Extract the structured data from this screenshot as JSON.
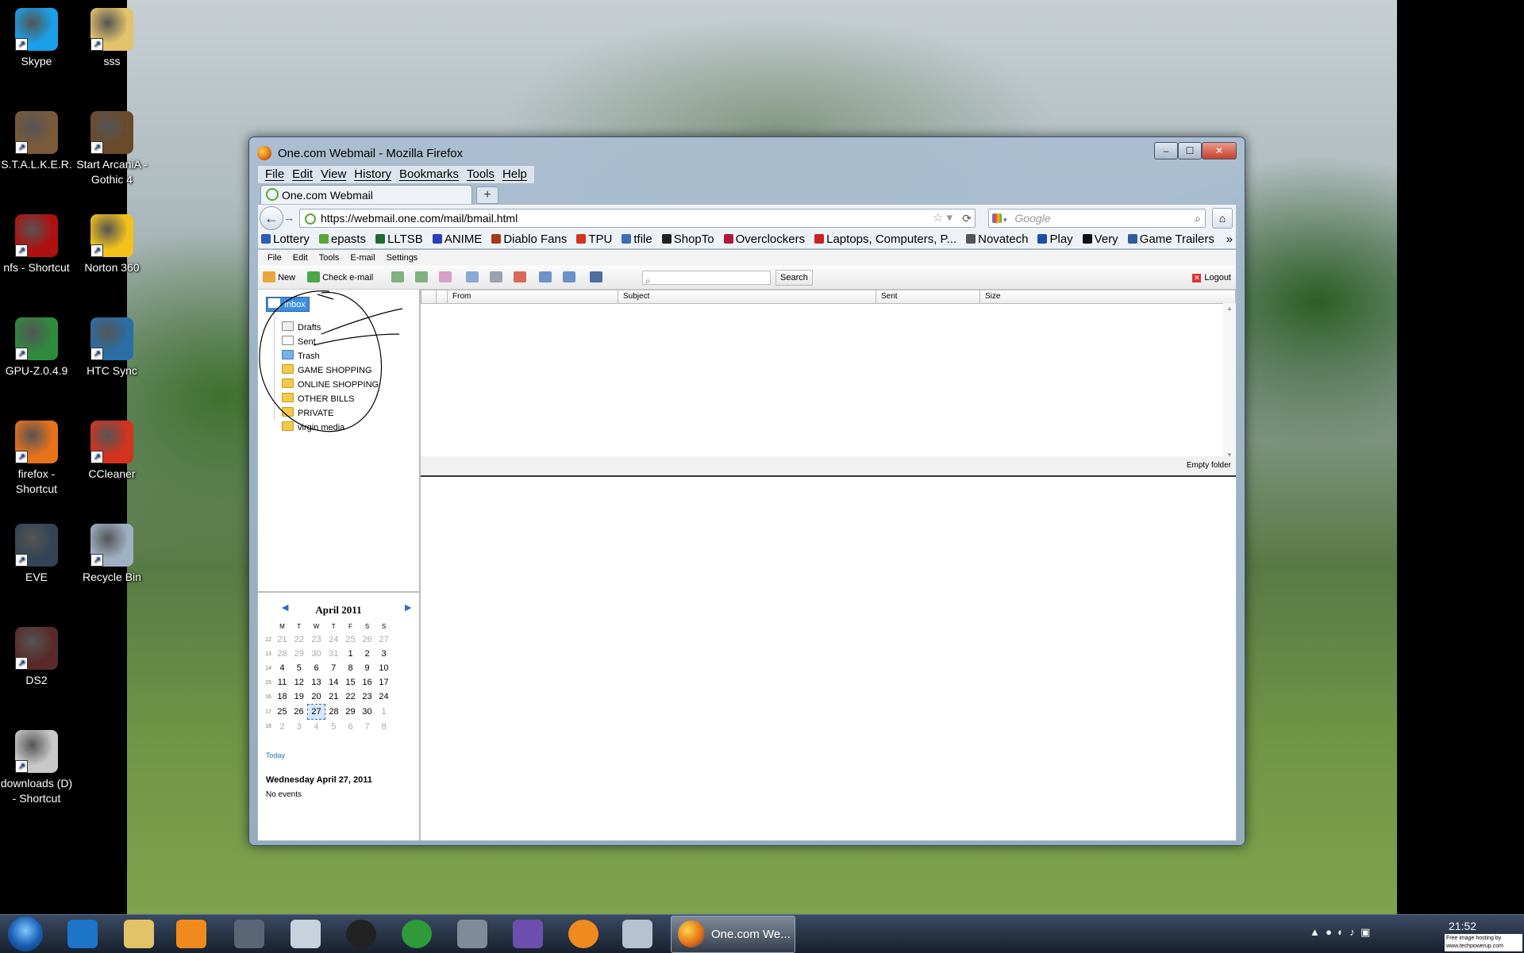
{
  "desktop": {
    "icons": [
      {
        "label": "Skype",
        "color": "#1aa0e8"
      },
      {
        "label": "sss",
        "color": "#e3c36a"
      },
      {
        "label": "S.T.A.L.K.E.R.",
        "color": "#7a5a3a"
      },
      {
        "label": "Start ArcaniA - Gothic 4",
        "color": "#6b4a2a"
      },
      {
        "label": "nfs - Shortcut",
        "color": "#b01010"
      },
      {
        "label": "Norton 360",
        "color": "#f2c21b"
      },
      {
        "label": "GPU-Z.0.4.9",
        "color": "#2e8b3e"
      },
      {
        "label": "HTC Sync",
        "color": "#2a6ea6"
      },
      {
        "label": "firefox - Shortcut",
        "color": "#e8711a"
      },
      {
        "label": "CCleaner",
        "color": "#d4331e"
      },
      {
        "label": "EVE",
        "color": "#334455"
      },
      {
        "label": "Recycle Bin",
        "color": "#9fb0c4"
      },
      {
        "label": "DS2",
        "color": "#5a2a2a"
      },
      {
        "label": "downloads (D) - Shortcut",
        "color": "#c8c8c8"
      }
    ]
  },
  "window": {
    "title": "One.com Webmail - Mozilla Firefox",
    "menu": [
      "File",
      "Edit",
      "View",
      "History",
      "Bookmarks",
      "Tools",
      "Help"
    ],
    "tab_label": "One.com Webmail",
    "new_tab": "+",
    "url": "https://webmail.one.com/mail/bmail.html",
    "search_placeholder": "Google",
    "bookmarks": [
      {
        "label": "Lottery",
        "color": "#2b5cb8"
      },
      {
        "label": "epasts",
        "color": "#58a63c"
      },
      {
        "label": "LLTSB",
        "color": "#1e6b34"
      },
      {
        "label": "ANIME",
        "color": "#2b3fb8"
      },
      {
        "label": "Diablo Fans",
        "color": "#a43b16"
      },
      {
        "label": "TPU",
        "color": "#d4331e"
      },
      {
        "label": "tfile",
        "color": "#3a6fb0"
      },
      {
        "label": "ShopTo",
        "color": "#222222"
      },
      {
        "label": "Overclockers",
        "color": "#b0183a"
      },
      {
        "label": "Laptops, Computers, P...",
        "color": "#c82020"
      },
      {
        "label": "Novatech",
        "color": "#555555"
      },
      {
        "label": "Play",
        "color": "#1a4ea8"
      },
      {
        "label": "Very",
        "color": "#111111"
      },
      {
        "label": "Game Trailers",
        "color": "#2b5c9a"
      }
    ],
    "bookmarks_more": "»"
  },
  "webmail": {
    "menu": [
      "File",
      "Edit",
      "Tools",
      "E-mail",
      "Settings"
    ],
    "toolbar": {
      "new": "New",
      "check": "Check e-mail",
      "search": "Search",
      "logout": "Logout"
    },
    "folders": [
      "Inbox",
      "Drafts",
      "Sent",
      "Trash",
      "GAME SHOPPING",
      "ONLINE SHOPPING",
      "OTHER BILLS",
      "PRIVATE",
      "virgin media"
    ],
    "columns": [
      "From",
      "Subject",
      "Sent",
      "Size"
    ],
    "empty_folder": "Empty folder",
    "calendar": {
      "month": "April 2011",
      "weekdays": [
        "M",
        "T",
        "W",
        "T",
        "F",
        "S",
        "S"
      ],
      "weeks": [
        {
          "wk": "12",
          "days": [
            "21",
            "22",
            "23",
            "24",
            "25",
            "26",
            "27"
          ]
        },
        {
          "wk": "13",
          "days": [
            "28",
            "29",
            "30",
            "31",
            "1",
            "2",
            "3"
          ]
        },
        {
          "wk": "14",
          "days": [
            "4",
            "5",
            "6",
            "7",
            "8",
            "9",
            "10"
          ]
        },
        {
          "wk": "15",
          "days": [
            "11",
            "12",
            "13",
            "14",
            "15",
            "16",
            "17"
          ]
        },
        {
          "wk": "16",
          "days": [
            "18",
            "19",
            "20",
            "21",
            "22",
            "23",
            "24"
          ]
        },
        {
          "wk": "17",
          "days": [
            "25",
            "26",
            "27",
            "28",
            "29",
            "30",
            "1"
          ]
        },
        {
          "wk": "18",
          "days": [
            "2",
            "3",
            "4",
            "5",
            "6",
            "7",
            "8"
          ]
        }
      ],
      "today_link": "Today",
      "selected_day": "Wednesday April 27, 2011",
      "events": "No events"
    }
  },
  "taskbar": {
    "active_app": "One.com We...",
    "clock": "21:52"
  },
  "watermark": "Free image hosting by www.techpowerup.com"
}
